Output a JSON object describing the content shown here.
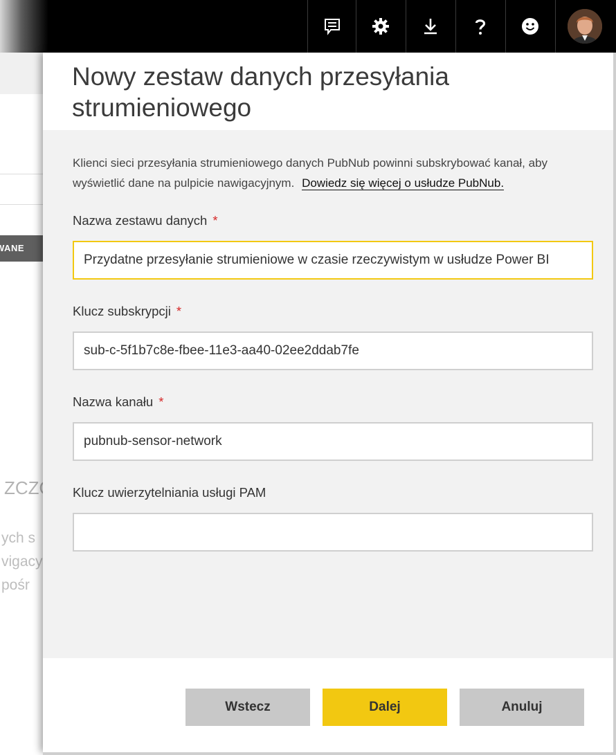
{
  "topbar": {
    "icons": [
      "notifications-icon",
      "gear-icon",
      "download-icon",
      "help-icon",
      "smiley-icon"
    ],
    "avatar": "user-avatar"
  },
  "background": {
    "pill_text": "WANE",
    "heading_fragment": "ZCZO",
    "text_lines": [
      "ych s",
      "vigacy",
      "pośr"
    ]
  },
  "dialog": {
    "title": "Nowy zestaw danych przesyłania strumieniowego",
    "description": "Klienci sieci przesyłania strumieniowego danych PubNub powinni subskrybować kanał, aby wyświetlić dane na pulpicie nawigacyjnym.",
    "learn_more_link": "Dowiedz się więcej o usłudze PubNub.",
    "required_marker": "*",
    "fields": {
      "dataset_name": {
        "label": "Nazwa zestawu danych",
        "value": "Przydatne przesyłanie strumieniowe w czasie rzeczywistym w usłudze Power BI",
        "required": true
      },
      "subscription_key": {
        "label": "Klucz subskrypcji",
        "value": "sub-c-5f1b7c8e-fbee-11e3-aa40-02ee2ddab7fe",
        "required": true
      },
      "channel_name": {
        "label": "Nazwa kanału",
        "value": "pubnub-sensor-network",
        "required": true
      },
      "pam_auth_key": {
        "label": "Klucz uwierzytelniania usługi PAM",
        "value": "",
        "required": false
      }
    },
    "buttons": {
      "back": "Wstecz",
      "next": "Dalej",
      "cancel": "Anuluj"
    },
    "colors": {
      "accent": "#f2c811",
      "required": "#d62b2b",
      "body_bg": "#f2f2f2"
    }
  }
}
